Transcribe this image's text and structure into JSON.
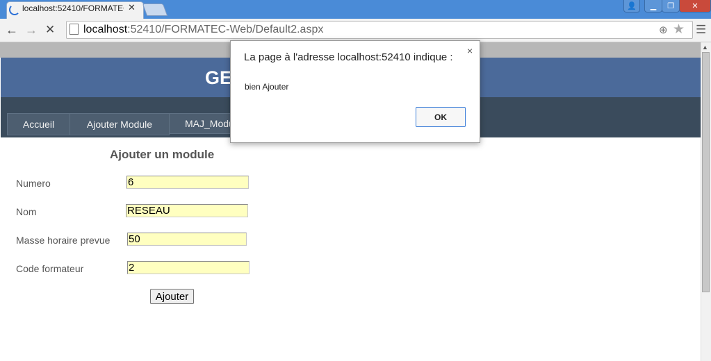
{
  "browser": {
    "tab_title": "localhost:52410/FORMATEC",
    "url_host": "localhost",
    "url_rest": ":52410/FORMATEC-Web/Default2.aspx"
  },
  "page": {
    "header_title": "GE",
    "nav": [
      "Accueil",
      "Ajouter Module",
      "MAJ_Modu"
    ],
    "form": {
      "title": "Ajouter un module",
      "fields": [
        {
          "label": "Numero",
          "value": "6"
        },
        {
          "label": "Nom",
          "value": "RESEAU"
        },
        {
          "label": "Masse horaire prevue",
          "value": "50"
        },
        {
          "label": "Code formateur",
          "value": "2"
        }
      ],
      "submit_label": "Ajouter"
    }
  },
  "dialog": {
    "title": "La page à l'adresse localhost:52410 indique :",
    "message": "bien Ajouter",
    "ok_label": "OK",
    "close_glyph": "×"
  },
  "colors": {
    "header_blue": "#4b6a9a",
    "nav_dark": "#3a4b5c",
    "input_yellow": "#ffffc0",
    "titlebar_blue": "#4a8bd7"
  }
}
